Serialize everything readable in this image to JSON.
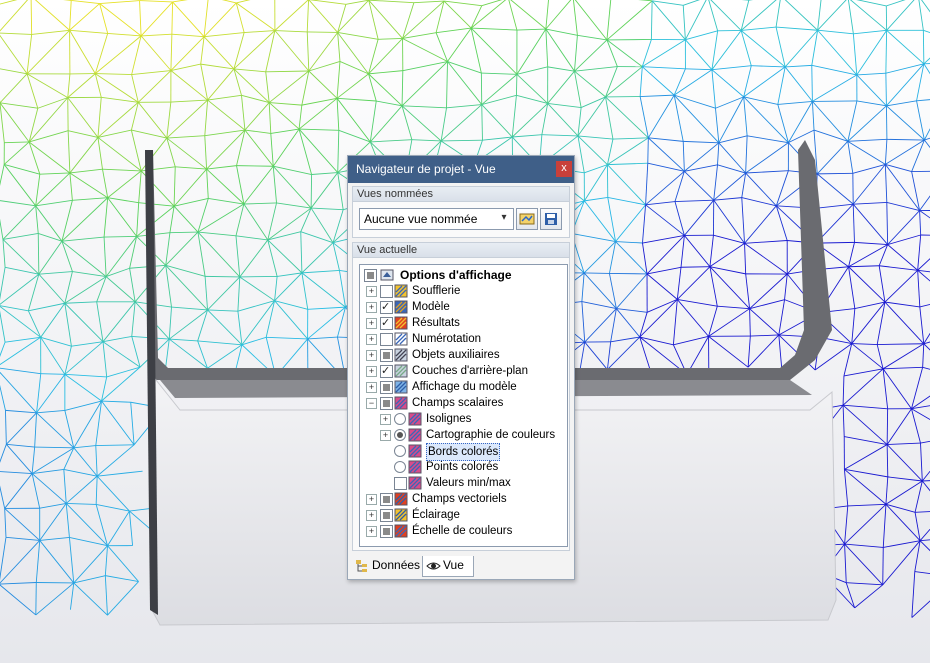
{
  "navigator": {
    "title": "Navigateur de projet - Vue",
    "close_glyph": "x",
    "named_views": {
      "header": "Vues nommées",
      "selected": "Aucune vue nommée"
    },
    "current_view": {
      "header": "Vue actuelle",
      "root": "Options d'affichage",
      "items": [
        {
          "label": "Soufflerie",
          "state": "unchecked",
          "icon": "wind-tunnel-icon"
        },
        {
          "label": "Modèle",
          "state": "checked",
          "icon": "model-icon"
        },
        {
          "label": "Résultats",
          "state": "checked",
          "icon": "results-icon"
        },
        {
          "label": "Numérotation",
          "state": "unchecked",
          "icon": "numbering-icon"
        },
        {
          "label": "Objets auxiliaires",
          "state": "mixed",
          "icon": "auxiliary-objects-icon"
        },
        {
          "label": "Couches d'arrière-plan",
          "state": "checked",
          "icon": "background-layers-icon"
        },
        {
          "label": "Affichage du modèle",
          "state": "mixed",
          "icon": "model-display-icon"
        },
        {
          "label": "Champs scalaires",
          "state": "mixed",
          "icon": "scalar-fields-icon"
        }
      ],
      "scalar_children": [
        {
          "label": "Isolignes",
          "type": "radio",
          "selected": false
        },
        {
          "label": "Cartographie de couleurs",
          "type": "radio",
          "selected": true
        },
        {
          "label": "Bords colorés",
          "type": "radio",
          "selected": false,
          "highlighted": true
        },
        {
          "label": "Points colorés",
          "type": "radio",
          "selected": false
        },
        {
          "label": "Valeurs min/max",
          "type": "checkbox",
          "selected": false
        }
      ],
      "bottom_items": [
        {
          "label": "Champs vectoriels",
          "state": "mixed",
          "icon": "vector-fields-icon"
        },
        {
          "label": "Éclairage",
          "state": "mixed",
          "icon": "lighting-icon"
        },
        {
          "label": "Échelle de couleurs",
          "state": "mixed",
          "icon": "color-scale-icon"
        }
      ]
    },
    "tabs": {
      "data": "Données",
      "view": "Vue"
    }
  },
  "colors": {
    "titlebar": "#3f5f88",
    "close": "#c9403a",
    "mesh_low": "#1a1ad0",
    "mesh_high": "#f0e020"
  }
}
